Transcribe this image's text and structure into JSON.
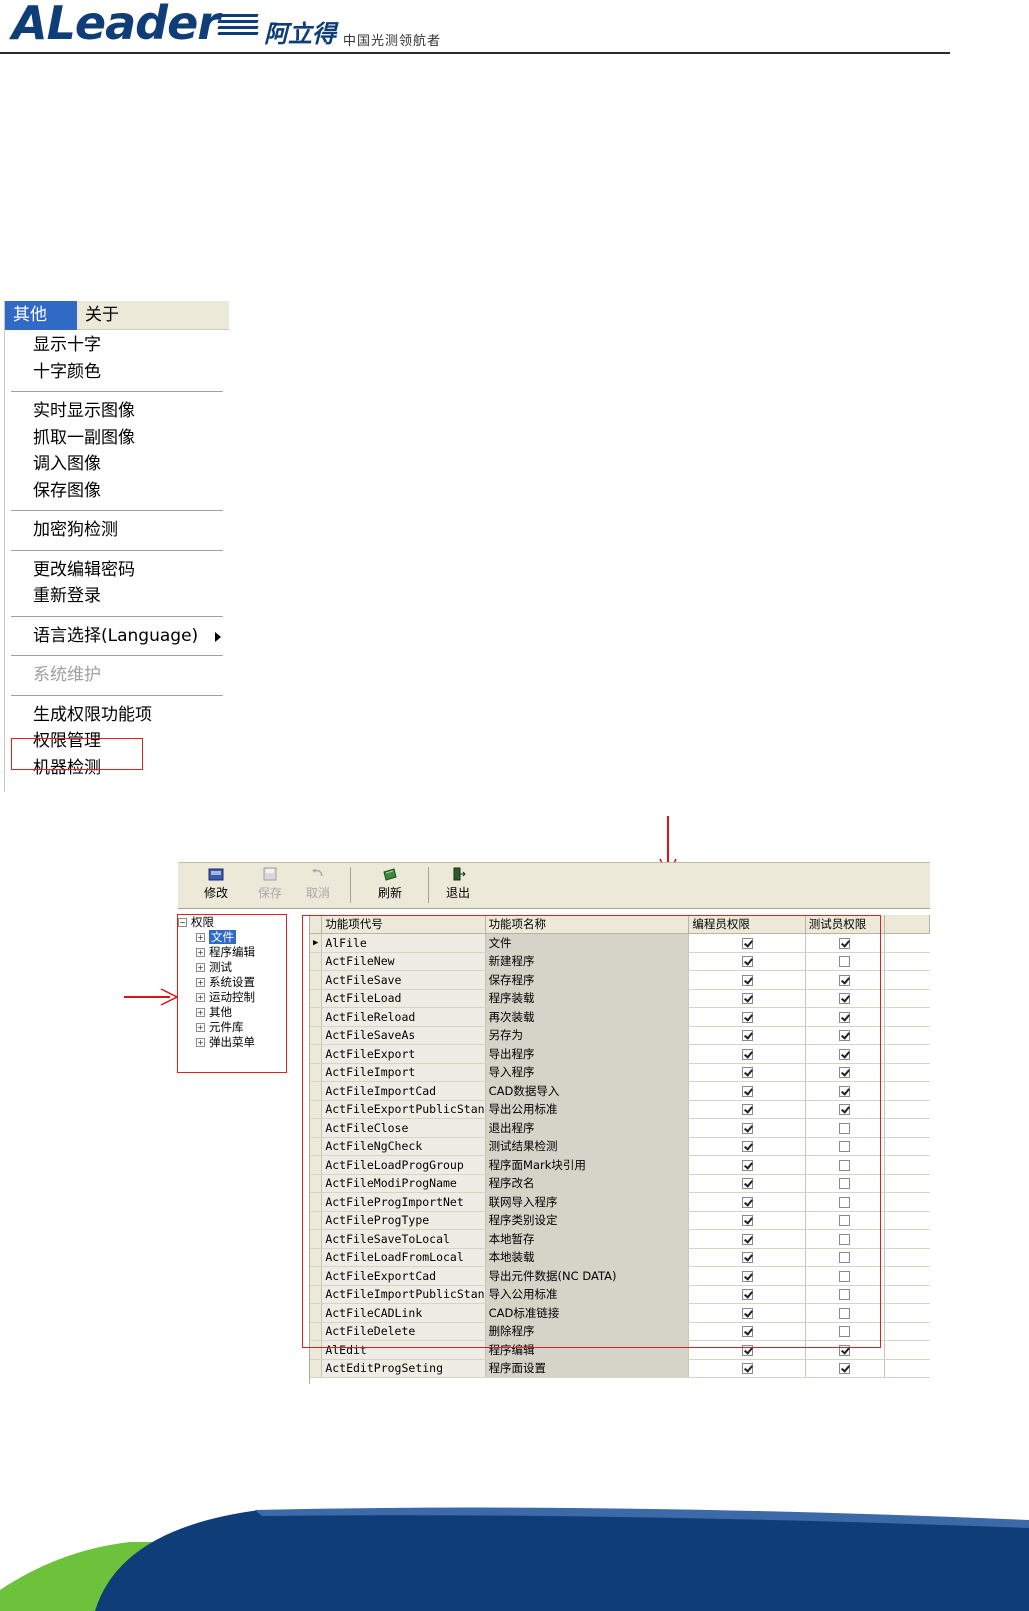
{
  "header": {
    "logo_text": "ALeader",
    "logo_cn": "阿立得",
    "slogan": "中国光测领航者"
  },
  "menu": {
    "menubar": [
      {
        "label": "其他",
        "active": true
      },
      {
        "label": "关于",
        "active": false
      }
    ],
    "items": [
      {
        "label": "显示十字"
      },
      {
        "label": "十字颜色"
      },
      {
        "separator": true
      },
      {
        "label": "实时显示图像"
      },
      {
        "label": "抓取一副图像"
      },
      {
        "label": "调入图像"
      },
      {
        "label": "保存图像"
      },
      {
        "separator": true
      },
      {
        "label": "加密狗检测"
      },
      {
        "separator": true
      },
      {
        "label": "更改编辑密码"
      },
      {
        "label": "重新登录"
      },
      {
        "separator": true
      },
      {
        "label": "语言选择(Language)",
        "submenu": true
      },
      {
        "separator": true
      },
      {
        "label": "系统维护",
        "disabled": true
      },
      {
        "separator": true
      },
      {
        "label": "生成权限功能项"
      },
      {
        "label": "权限管理",
        "highlighted": true
      },
      {
        "label": "机器检测"
      }
    ]
  },
  "toolbar": {
    "buttons": [
      {
        "label": "修改",
        "icon": "edit-icon",
        "disabled": false
      },
      {
        "label": "保存",
        "icon": "save-icon",
        "disabled": true
      },
      {
        "label": "取消",
        "icon": "undo-icon",
        "disabled": true
      },
      {
        "label": "刷新",
        "icon": "refresh-icon",
        "disabled": false
      },
      {
        "label": "退出",
        "icon": "exit-icon",
        "disabled": false
      }
    ]
  },
  "tree": {
    "root": "权限",
    "children": [
      "文件",
      "程序编辑",
      "测试",
      "系统设置",
      "运动控制",
      "其他",
      "元件库",
      "弹出菜单"
    ],
    "selected": "文件"
  },
  "grid": {
    "columns": [
      "功能项代号",
      "功能项名称",
      "编程员权限",
      "测试员权限"
    ],
    "rows": [
      {
        "code": "AlFile",
        "name": "文件",
        "programmer": true,
        "tester": true
      },
      {
        "code": "ActFileNew",
        "name": "新建程序",
        "programmer": true,
        "tester": false
      },
      {
        "code": "ActFileSave",
        "name": "保存程序",
        "programmer": true,
        "tester": true
      },
      {
        "code": "ActFileLoad",
        "name": "程序装载",
        "programmer": true,
        "tester": true
      },
      {
        "code": "ActFileReload",
        "name": "再次装载",
        "programmer": true,
        "tester": true
      },
      {
        "code": "ActFileSaveAs",
        "name": "另存为",
        "programmer": true,
        "tester": true
      },
      {
        "code": "ActFileExport",
        "name": "导出程序",
        "programmer": true,
        "tester": true
      },
      {
        "code": "ActFileImport",
        "name": "导入程序",
        "programmer": true,
        "tester": true
      },
      {
        "code": "ActFileImportCad",
        "name": "CAD数据导入",
        "programmer": true,
        "tester": true
      },
      {
        "code": "ActFileExportPublicStan",
        "name": "导出公用标准",
        "programmer": true,
        "tester": true
      },
      {
        "code": "ActFileClose",
        "name": "退出程序",
        "programmer": true,
        "tester": false
      },
      {
        "code": "ActFileNgCheck",
        "name": "测试结果检测",
        "programmer": true,
        "tester": false
      },
      {
        "code": "ActFileLoadProgGroup",
        "name": "程序面Mark块引用",
        "programmer": true,
        "tester": false
      },
      {
        "code": "ActFileModiProgName",
        "name": "程序改名",
        "programmer": true,
        "tester": false
      },
      {
        "code": "ActFileProgImportNet",
        "name": "联网导入程序",
        "programmer": true,
        "tester": false
      },
      {
        "code": "ActFileProgType",
        "name": "程序类别设定",
        "programmer": true,
        "tester": false
      },
      {
        "code": "ActFileSaveToLocal",
        "name": "本地暂存",
        "programmer": true,
        "tester": false
      },
      {
        "code": "ActFileLoadFromLocal",
        "name": "本地装载",
        "programmer": true,
        "tester": false
      },
      {
        "code": "ActFileExportCad",
        "name": "导出元件数据(NC DATA)",
        "programmer": true,
        "tester": false
      },
      {
        "code": "ActFileImportPublicStan",
        "name": "导入公用标准",
        "programmer": true,
        "tester": false
      },
      {
        "code": "ActFileCADLink",
        "name": "CAD标准链接",
        "programmer": true,
        "tester": false
      },
      {
        "code": "ActFileDelete",
        "name": "删除程序",
        "programmer": true,
        "tester": false
      },
      {
        "code": "AlEdit",
        "name": "程序编辑",
        "programmer": true,
        "tester": true
      },
      {
        "code": "ActEditProgSeting",
        "name": "程序面设置",
        "programmer": true,
        "tester": true
      }
    ]
  },
  "colors": {
    "brand": "#0e3d78",
    "annotation": "#e02020",
    "selection": "#316ac5",
    "chrome": "#ece9d8"
  }
}
